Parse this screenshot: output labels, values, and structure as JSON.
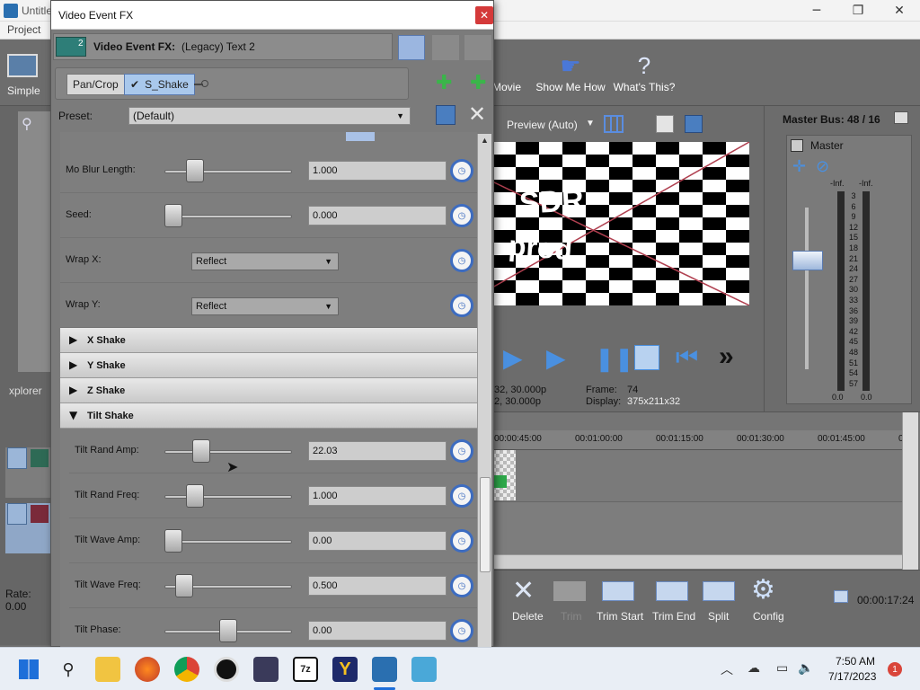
{
  "app": {
    "title_fragment": "Untitle",
    "menu": [
      "Project"
    ],
    "toolbar_left": "Simple",
    "toolbar_buttons": [
      {
        "label": "Movie"
      },
      {
        "label": "Show Me How"
      },
      {
        "label": "What's This?"
      }
    ],
    "explorer_label": "xplorer",
    "rate_label": "Rate: 0.00"
  },
  "dialog": {
    "title": "Video Event FX",
    "fx_badge": "2",
    "fx_header_label": "Video Event FX:",
    "fx_header_value": "(Legacy) Text 2",
    "chain": {
      "pan_crop": "Pan/Crop",
      "shake": "S_Shake"
    },
    "preset_label": "Preset:",
    "preset_value": "(Default)",
    "params_top": [
      {
        "label": "Mo Blur Length:",
        "value": "1.000",
        "thumb": 0.2
      },
      {
        "label": "Seed:",
        "value": "0.000",
        "thumb": 0.0
      }
    ],
    "dropdowns": [
      {
        "label": "Wrap X:",
        "value": "Reflect"
      },
      {
        "label": "Wrap Y:",
        "value": "Reflect"
      }
    ],
    "sections_collapsed": [
      "X Shake",
      "Y Shake",
      "Z Shake"
    ],
    "section_open": "Tilt Shake",
    "params_tilt": [
      {
        "label": "Tilt Rand Amp:",
        "value": "22.03",
        "thumb": 0.25
      },
      {
        "label": "Tilt Rand Freq:",
        "value": "1.000",
        "thumb": 0.2
      },
      {
        "label": "Tilt Wave Amp:",
        "value": "0.00",
        "thumb": 0.0
      },
      {
        "label": "Tilt Wave Freq:",
        "value": "0.500",
        "thumb": 0.1
      },
      {
        "label": "Tilt Phase:",
        "value": "0.00",
        "thumb": 0.5
      }
    ]
  },
  "preview": {
    "mode": "Preview (Auto)",
    "overlay_text_1": "SDR",
    "overlay_text_2": "prod.",
    "info_left_1": "32, 30.000p",
    "info_left_2": "2, 30.000p",
    "frame_label": "Frame:",
    "frame_value": "74",
    "display_label": "Display:",
    "display_value": "375x211x32"
  },
  "master": {
    "title": "Master Bus: 48 / 16",
    "channel": "Master",
    "meter_top_left": "-Inf.",
    "meter_top_right": "-Inf.",
    "scale": [
      "3",
      "6",
      "9",
      "12",
      "15",
      "18",
      "21",
      "24",
      "27",
      "30",
      "33",
      "36",
      "39",
      "42",
      "45",
      "48",
      "51",
      "54",
      "57"
    ],
    "meter_bottom_left": "0.0",
    "meter_bottom_right": "0.0"
  },
  "timeline": {
    "ticks": [
      "00:00:45:00",
      "00:01:00:00",
      "00:01:15:00",
      "00:01:30:00",
      "00:01:45:00",
      "00:0"
    ]
  },
  "editbar": {
    "delete": "Delete",
    "trim": "Trim",
    "trim_start": "Trim Start",
    "trim_end": "Trim End",
    "split": "Split",
    "config": "Config",
    "timecode": "00:00:17:24"
  },
  "taskbar": {
    "time": "7:50 AM",
    "date": "7/17/2023",
    "notification_count": "1"
  },
  "colors": {
    "clock_ring": "#3d6cc0",
    "close_red": "#d43a3a",
    "section_bg": "#d8d8d8"
  }
}
